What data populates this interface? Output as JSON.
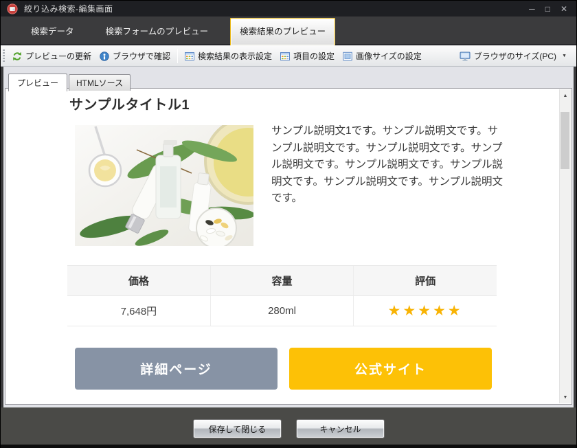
{
  "window": {
    "title": "絞り込み検索-編集画面",
    "minimize": "─",
    "maximize": "□",
    "close": "✕"
  },
  "tabs": {
    "items": [
      {
        "label": "検索データ"
      },
      {
        "label": "検索フォームのプレビュー"
      },
      {
        "label": "検索結果のプレビュー"
      }
    ]
  },
  "toolbar": {
    "update_preview": "プレビューの更新",
    "check_browser": "ブラウザで確認",
    "display_settings": "検索結果の表示設定",
    "item_settings": "項目の設定",
    "image_size_settings": "画像サイズの設定",
    "browser_size": "ブラウザのサイズ(PC)",
    "dropdown_glyph": "▼"
  },
  "subtabs": {
    "preview": "プレビュー",
    "html_source": "HTMLソース"
  },
  "content": {
    "title": "サンプルタイトル1",
    "description": "サンプル説明文1です。サンプル説明文です。サンプル説明文です。サンプル説明文です。サンプル説明文です。サンプル説明文です。サンプル説明文です。サンプル説明文です。サンプル説明文です。",
    "table": {
      "headers": [
        "価格",
        "容量",
        "評価"
      ],
      "price": "7,648円",
      "volume": "280ml",
      "rating": "★★★★★"
    },
    "detail_button": "詳細ページ",
    "official_button": "公式サイト"
  },
  "scrollbar": {
    "up": "▲",
    "down": "▼"
  },
  "footer": {
    "save_close": "保存して閉じる",
    "cancel": "キャンセル"
  },
  "colors": {
    "accent_tab_border": "#e9b616",
    "star": "#f8b303",
    "detail_button_bg": "#8793a5",
    "official_button_bg": "#fdc106",
    "footer_bg": "#4a4a47"
  }
}
